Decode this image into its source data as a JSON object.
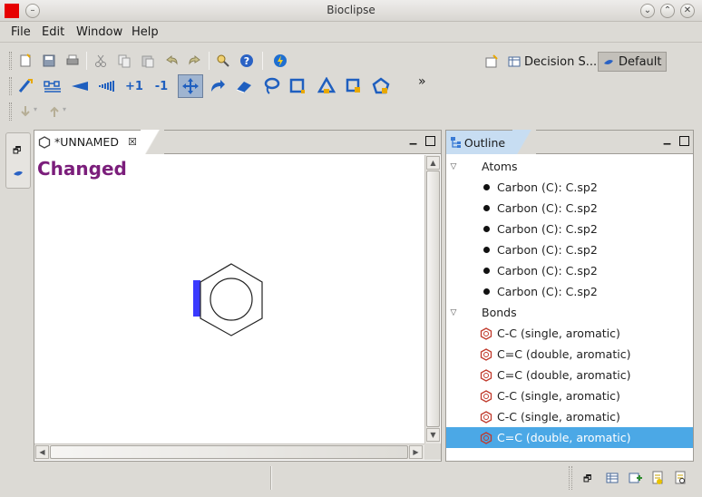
{
  "window": {
    "title": "Bioclipse",
    "controls": [
      "minimize",
      "maximize",
      "close"
    ]
  },
  "menu": [
    "File",
    "Edit",
    "Window",
    "Help"
  ],
  "toolbar": {
    "row1_icons": [
      "new-file-icon",
      "save-icon",
      "print-icon",
      "cut-icon",
      "copy-icon",
      "paste-icon",
      "undo-icon",
      "redo-icon",
      "help-search-icon",
      "help-icon",
      "lightning-icon"
    ],
    "row2_icons": [
      "draw-bond-icon",
      "chain-icon",
      "wedge-bond-icon",
      "hash-bond-icon",
      "charge-plus-icon",
      "charge-minus-icon",
      "move-icon",
      "rotate-icon",
      "eraser-icon",
      "lasso-icon",
      "select-rect-icon",
      "triangle-ring-icon",
      "square-ring-icon",
      "pentagon-ring-icon"
    ],
    "row2_text": {
      "charge_plus": "+1",
      "charge_minus": "-1"
    },
    "overflow": "»"
  },
  "perspectives": {
    "items": [
      {
        "label": "Decision S...",
        "active": false
      },
      {
        "label": "Default",
        "active": true
      }
    ]
  },
  "editor": {
    "tab_label": "*UNNAMED",
    "status_text": "Changed",
    "status_color": "#7b1e7b",
    "highlight_color": "#3a3aff"
  },
  "outline": {
    "tab_label": "Outline",
    "groups": [
      {
        "label": "Atoms",
        "items": [
          "Carbon (C): C.sp2",
          "Carbon (C): C.sp2",
          "Carbon (C): C.sp2",
          "Carbon (C): C.sp2",
          "Carbon (C): C.sp2",
          "Carbon (C): C.sp2"
        ]
      },
      {
        "label": "Bonds",
        "items": [
          "C-C (single, aromatic)",
          "C=C (double, aromatic)",
          "C=C (double, aromatic)",
          "C-C (single, aromatic)",
          "C-C (single, aromatic)",
          "C=C (double, aromatic)"
        ]
      }
    ],
    "selected_index": 5,
    "selection_color": "#4ba8e6"
  },
  "statusbar": {
    "icons": [
      "restore-icon",
      "table-icon",
      "add-icon",
      "report-icon",
      "report-search-icon"
    ]
  }
}
